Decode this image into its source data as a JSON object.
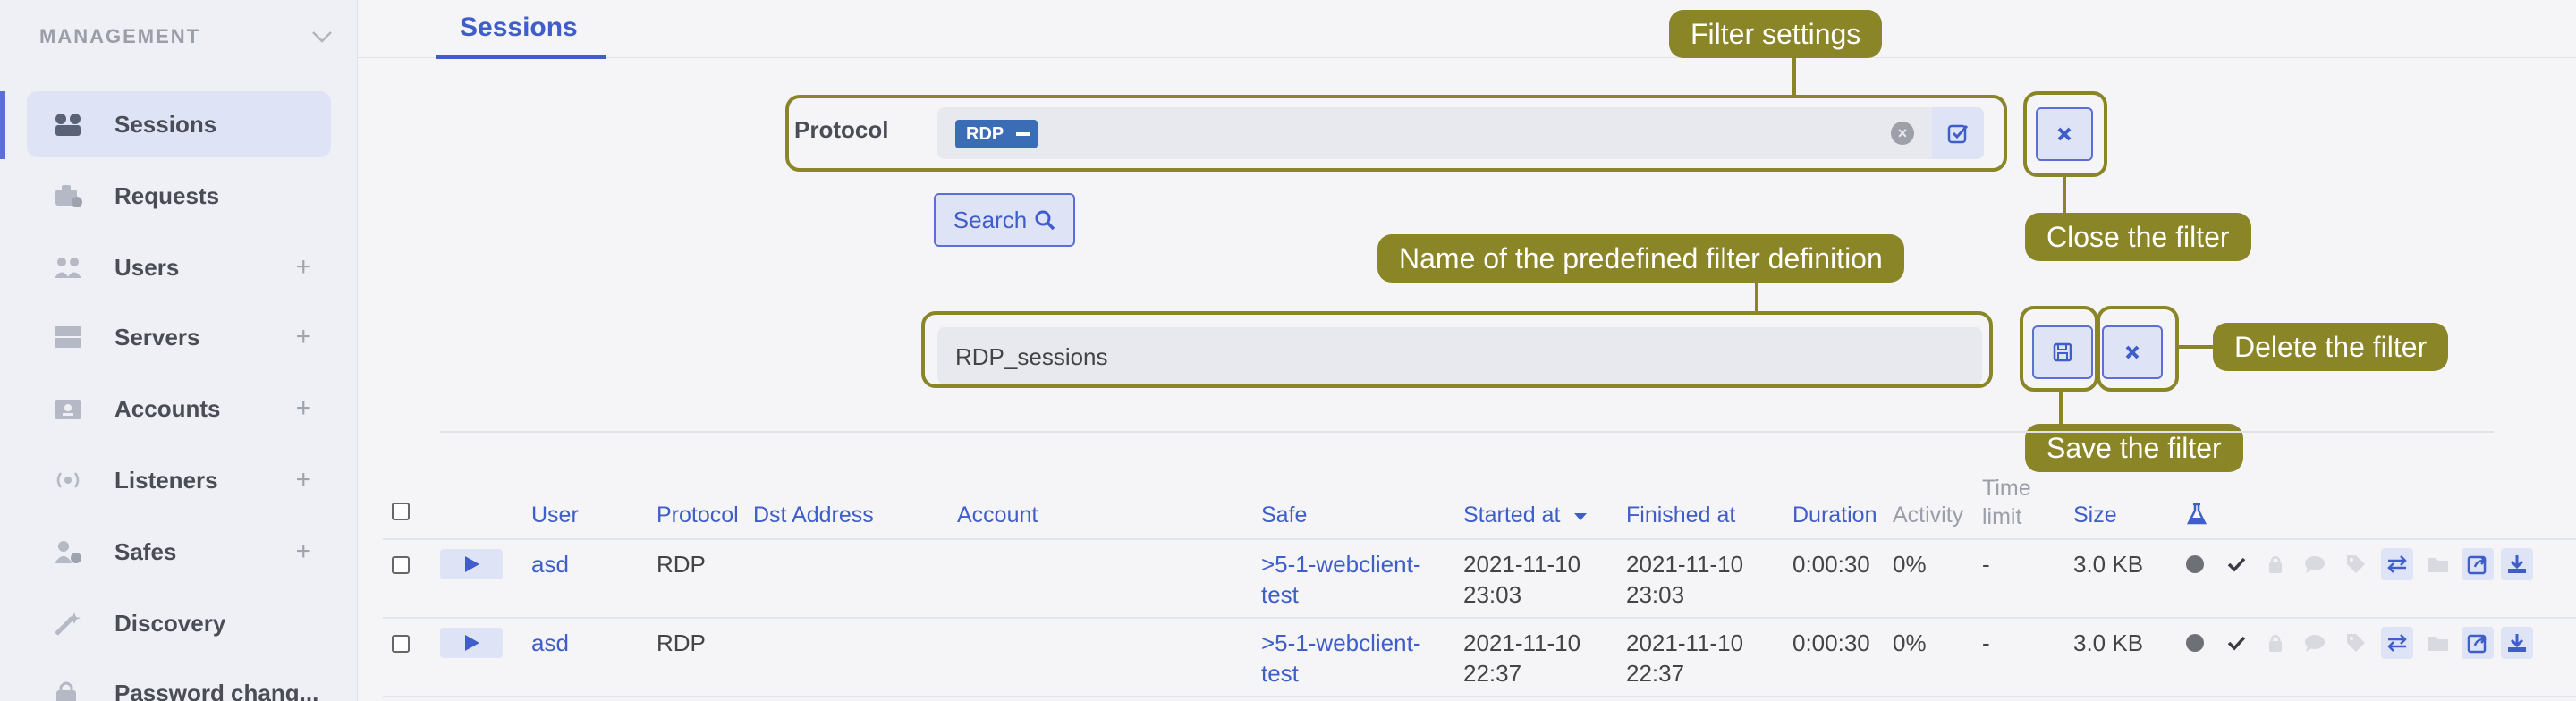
{
  "sidebar": {
    "section_title": "MANAGEMENT",
    "items": [
      {
        "label": "Sessions",
        "icon": "sessions-icon"
      },
      {
        "label": "Requests",
        "icon": "requests-icon"
      },
      {
        "label": "Users",
        "icon": "users-icon",
        "plus": "+"
      },
      {
        "label": "Servers",
        "icon": "servers-icon",
        "plus": "+"
      },
      {
        "label": "Accounts",
        "icon": "accounts-icon",
        "plus": "+"
      },
      {
        "label": "Listeners",
        "icon": "listeners-icon",
        "plus": "+"
      },
      {
        "label": "Safes",
        "icon": "safes-icon",
        "plus": "+"
      },
      {
        "label": "Discovery",
        "icon": "discovery-icon"
      },
      {
        "label": "Password chang...",
        "icon": "password-change-icon"
      }
    ]
  },
  "header": {
    "tab_label": "Sessions"
  },
  "filter": {
    "protocol_label": "Protocol",
    "protocol_tag": "RDP",
    "search_label": "Search",
    "filter_name_value": "RDP_sessions"
  },
  "callouts": {
    "filter_settings": "Filter settings",
    "close_filter": "Close the filter",
    "filter_name": "Name of the predefined filter definition",
    "delete_filter": "Delete the filter",
    "save_filter": "Save the filter"
  },
  "table": {
    "headers": {
      "user": "User",
      "protocol": "Protocol",
      "dst_address": "Dst Address",
      "account": "Account",
      "safe": "Safe",
      "started_at": "Started at",
      "finished_at": "Finished at",
      "duration": "Duration",
      "activity": "Activity",
      "time_limit_1": "Time",
      "time_limit_2": "limit",
      "size": "Size"
    },
    "rows": [
      {
        "user": "asd",
        "protocol": "RDP",
        "safe_1": ">5-1-webclient-",
        "safe_2": "test",
        "started_1": "2021-11-10",
        "started_2": "23:03",
        "finished_1": "2021-11-10",
        "finished_2": "23:03",
        "duration": "0:00:30",
        "activity": "0%",
        "time_limit": "-",
        "size": "3.0 KB"
      },
      {
        "user": "asd",
        "protocol": "RDP",
        "safe_1": ">5-1-webclient-",
        "safe_2": "test",
        "started_1": "2021-11-10",
        "started_2": "22:37",
        "finished_1": "2021-11-10",
        "finished_2": "22:37",
        "duration": "0:00:30",
        "activity": "0%",
        "time_limit": "-",
        "size": "3.0 KB"
      }
    ]
  },
  "colors": {
    "accent": "#3f5ec9",
    "callout": "#8a8527",
    "sidebar_bg": "#eef0f6"
  }
}
